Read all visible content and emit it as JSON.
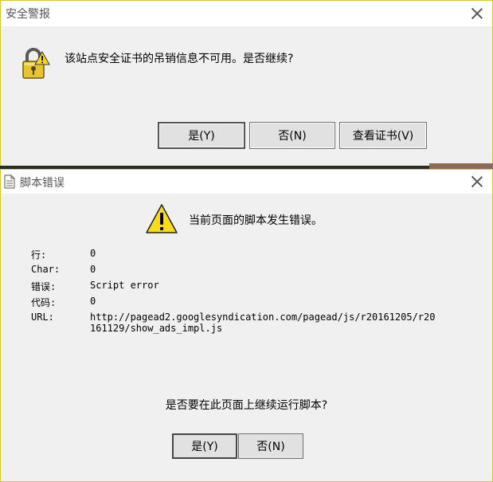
{
  "security_alert": {
    "title": "安全警报",
    "icon": "lock-warning-icon",
    "message": "该站点安全证书的吊销信息不可用。是否继续?",
    "buttons": {
      "yes": "是(Y)",
      "no": "否(N)",
      "view_cert": "查看证书(V)"
    }
  },
  "script_error": {
    "title": "脚本错误",
    "icon": "warning-icon",
    "message": "当前页面的脚本发生错误。",
    "details": [
      {
        "key": "行:",
        "value": "0"
      },
      {
        "key": "Char:",
        "value": "0"
      },
      {
        "key": "错误:",
        "value": "Script error"
      },
      {
        "key": "代码:",
        "value": "0"
      },
      {
        "key": "URL:",
        "value": "http://pagead2.googlesyndication.com/pagead/js/r20161205/r20161129/show_ads_impl.js"
      }
    ],
    "question": "是否要在此页面上继续运行脚本?",
    "buttons": {
      "yes": "是(Y)",
      "no": "否(N)"
    }
  },
  "colors": {
    "dialog_border": "#d4c62e",
    "dialog_bg": "#f0f0f0",
    "titlebar_bg": "#ffffff"
  }
}
